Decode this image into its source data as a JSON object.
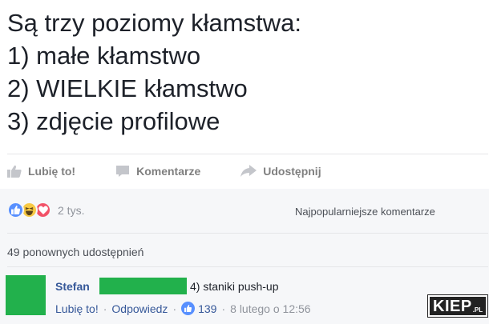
{
  "post": {
    "lines": [
      "Są trzy poziomy kłamstwa:",
      "1) małe kłamstwo",
      "2) WIELKIE kłamstwo",
      "3) zdjęcie profilowe"
    ]
  },
  "actions": {
    "like": "Lubię to!",
    "comment": "Komentarze",
    "share": "Udostępnij"
  },
  "reactions": {
    "count": "2 tys.",
    "sort_label": "Najpopularniejsze komentarze"
  },
  "shares_text": "49 ponownych udostępnień",
  "comment": {
    "author": "Stefan",
    "text": "4) staniki push-up",
    "like_link": "Lubię to!",
    "reply_link": "Odpowiedz",
    "like_count": "139",
    "time": "8 lutego o 12:56"
  },
  "watermark": {
    "main": "KIEP",
    "suffix": ".PL"
  },
  "colors": {
    "facebook_blue": "#365899",
    "like_blue": "#5890ff",
    "haha_yellow": "#f7c945",
    "love_red": "#f25268",
    "redaction_green": "#22b14c"
  }
}
